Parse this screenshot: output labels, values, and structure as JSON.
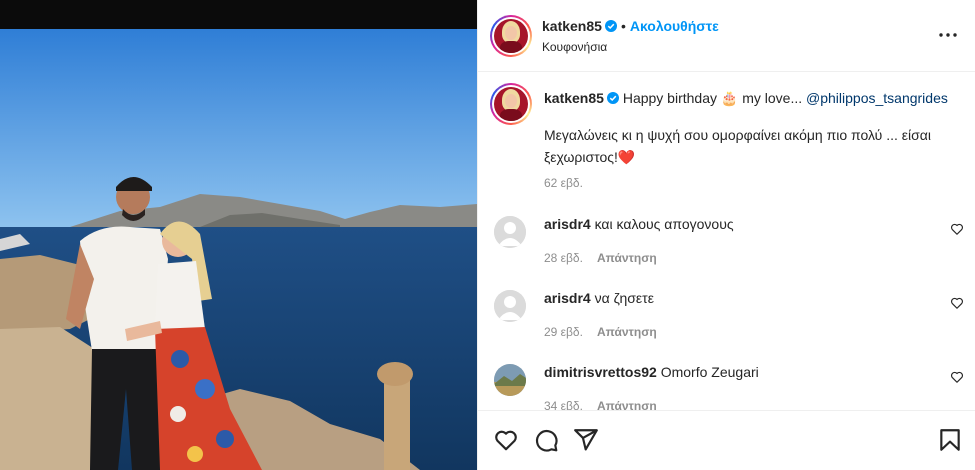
{
  "post": {
    "author": "katken85",
    "follow_label": "Ακολουθήστε",
    "dot": "•",
    "location": "Κουφονήσια"
  },
  "caption": {
    "author": "katken85",
    "text_start": "Happy birthday",
    "cake_emoji": "🎂",
    "text_mid": "my love...",
    "mention": "@philippos_tsangrides",
    "body": "Μεγαλώνεις κι η ψυχή σου ομορφαίνει ακόμη πιο πολύ ... είσαι ξεχωριστος!",
    "heart_emoji": "❤️",
    "time": "62 εβδ."
  },
  "comments": [
    {
      "user": "arisdr4",
      "text": "και καλους απογονους",
      "time": "28 εβδ.",
      "reply": "Απάντηση",
      "avatar": "default-avatar"
    },
    {
      "user": "arisdr4",
      "text": "να ζησετε",
      "time": "29 εβδ.",
      "reply": "Απάντηση",
      "avatar": "default-avatar"
    },
    {
      "user": "dimitrisvrettos92",
      "text": "Omorfo Zeugari",
      "time": "34 εβδ.",
      "reply": "Απάντηση",
      "avatar": "landscape-avatar"
    }
  ],
  "icons": {
    "header": [
      "verified-badge-icon",
      "more-options-icon"
    ],
    "actions": [
      "like-heart-icon",
      "comment-icon",
      "share-icon",
      "save-bookmark-icon"
    ],
    "comment_like": "heart-outline-icon"
  },
  "colors": {
    "link_blue": "#0095f6",
    "mention": "#00376b",
    "muted": "#8e8e8e",
    "verified": "#0095f6"
  }
}
